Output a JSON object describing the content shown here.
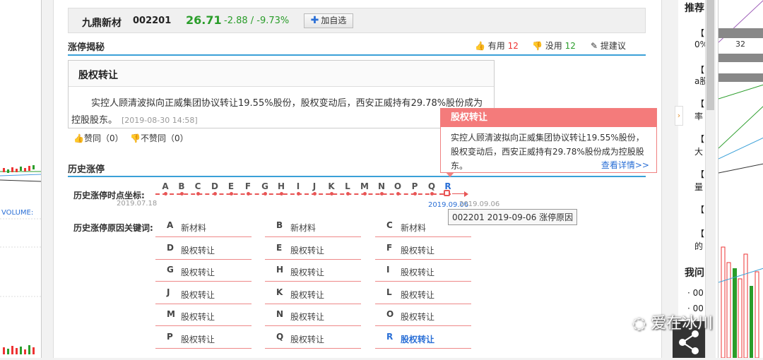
{
  "stock": {
    "name": "九鼎新材",
    "code": "002201",
    "price": "26.71",
    "change": "-2.88 / -9.73%",
    "add_watch": "加自选"
  },
  "section_reason": {
    "title": "涨停揭秘",
    "useful_label": "有用",
    "useful_count": "12",
    "useless_label": "没用",
    "useless_count": "12",
    "suggest_label": "提建议"
  },
  "reason_card": {
    "title": "股权转让",
    "text": "实控人顾清波拟向正威集团协议转让19.55%股份，股权变动后，西安正威持有29.78%股份成为控股股东。",
    "time": "[2019-08-30 14:58]",
    "agree": "赞同（0）",
    "disagree": "不赞同（0）"
  },
  "tooltip": {
    "title": "股权转让",
    "text": "实控人顾清波拟向正威集团协议转让19.55%股份，股权变动后，西安正威持有29.78%股份成为控股股东。",
    "more": "查看详情>>"
  },
  "history": {
    "title": "历史涨停",
    "axis_label": "历史涨停时点坐标:",
    "keyword_label": "历史涨停原因关键词:",
    "letters": [
      "A",
      "B",
      "C",
      "D",
      "E",
      "F",
      "G",
      "H",
      "I",
      "J",
      "K",
      "L",
      "M",
      "N",
      "O",
      "P",
      "Q",
      "R"
    ],
    "start_date": "2019.07.18",
    "selected_date": "2019.09.06",
    "end_date": "2019.09.06",
    "hover_text": "002201 2019-09-06 涨停原因",
    "keywords": [
      [
        "A",
        "新材料"
      ],
      [
        "B",
        "新材料"
      ],
      [
        "C",
        "新材料"
      ],
      [
        "D",
        "股权转让"
      ],
      [
        "E",
        "股权转让"
      ],
      [
        "F",
        "股权转让"
      ],
      [
        "G",
        "股权转让"
      ],
      [
        "H",
        "股权转让"
      ],
      [
        "I",
        "股权转让"
      ],
      [
        "J",
        "股权转让"
      ],
      [
        "K",
        "股权转让"
      ],
      [
        "L",
        "股权转让"
      ],
      [
        "M",
        "股权转让"
      ],
      [
        "N",
        "股权转让"
      ],
      [
        "O",
        "股权转让"
      ],
      [
        "P",
        "股权转让"
      ],
      [
        "Q",
        "股权转让"
      ],
      [
        "R",
        "股权转让"
      ]
    ]
  },
  "right": {
    "recommend": "推荐",
    "ask": "我问",
    "item_prefix": "【",
    "r1": "0%",
    "r2": "a股",
    "r3": "率",
    "r4": "大",
    "r5": "量",
    "r6": "的",
    "q1": "· 00",
    "q2": "· 00",
    "num": "32"
  },
  "left_chart": {
    "volume_label": "VOLUME:"
  },
  "watermark": "爱在冰川",
  "colors": {
    "up": "#e33333",
    "down": "#2a9d2a",
    "accent": "#3aa0d8",
    "tooltip": "#f47b7b"
  }
}
